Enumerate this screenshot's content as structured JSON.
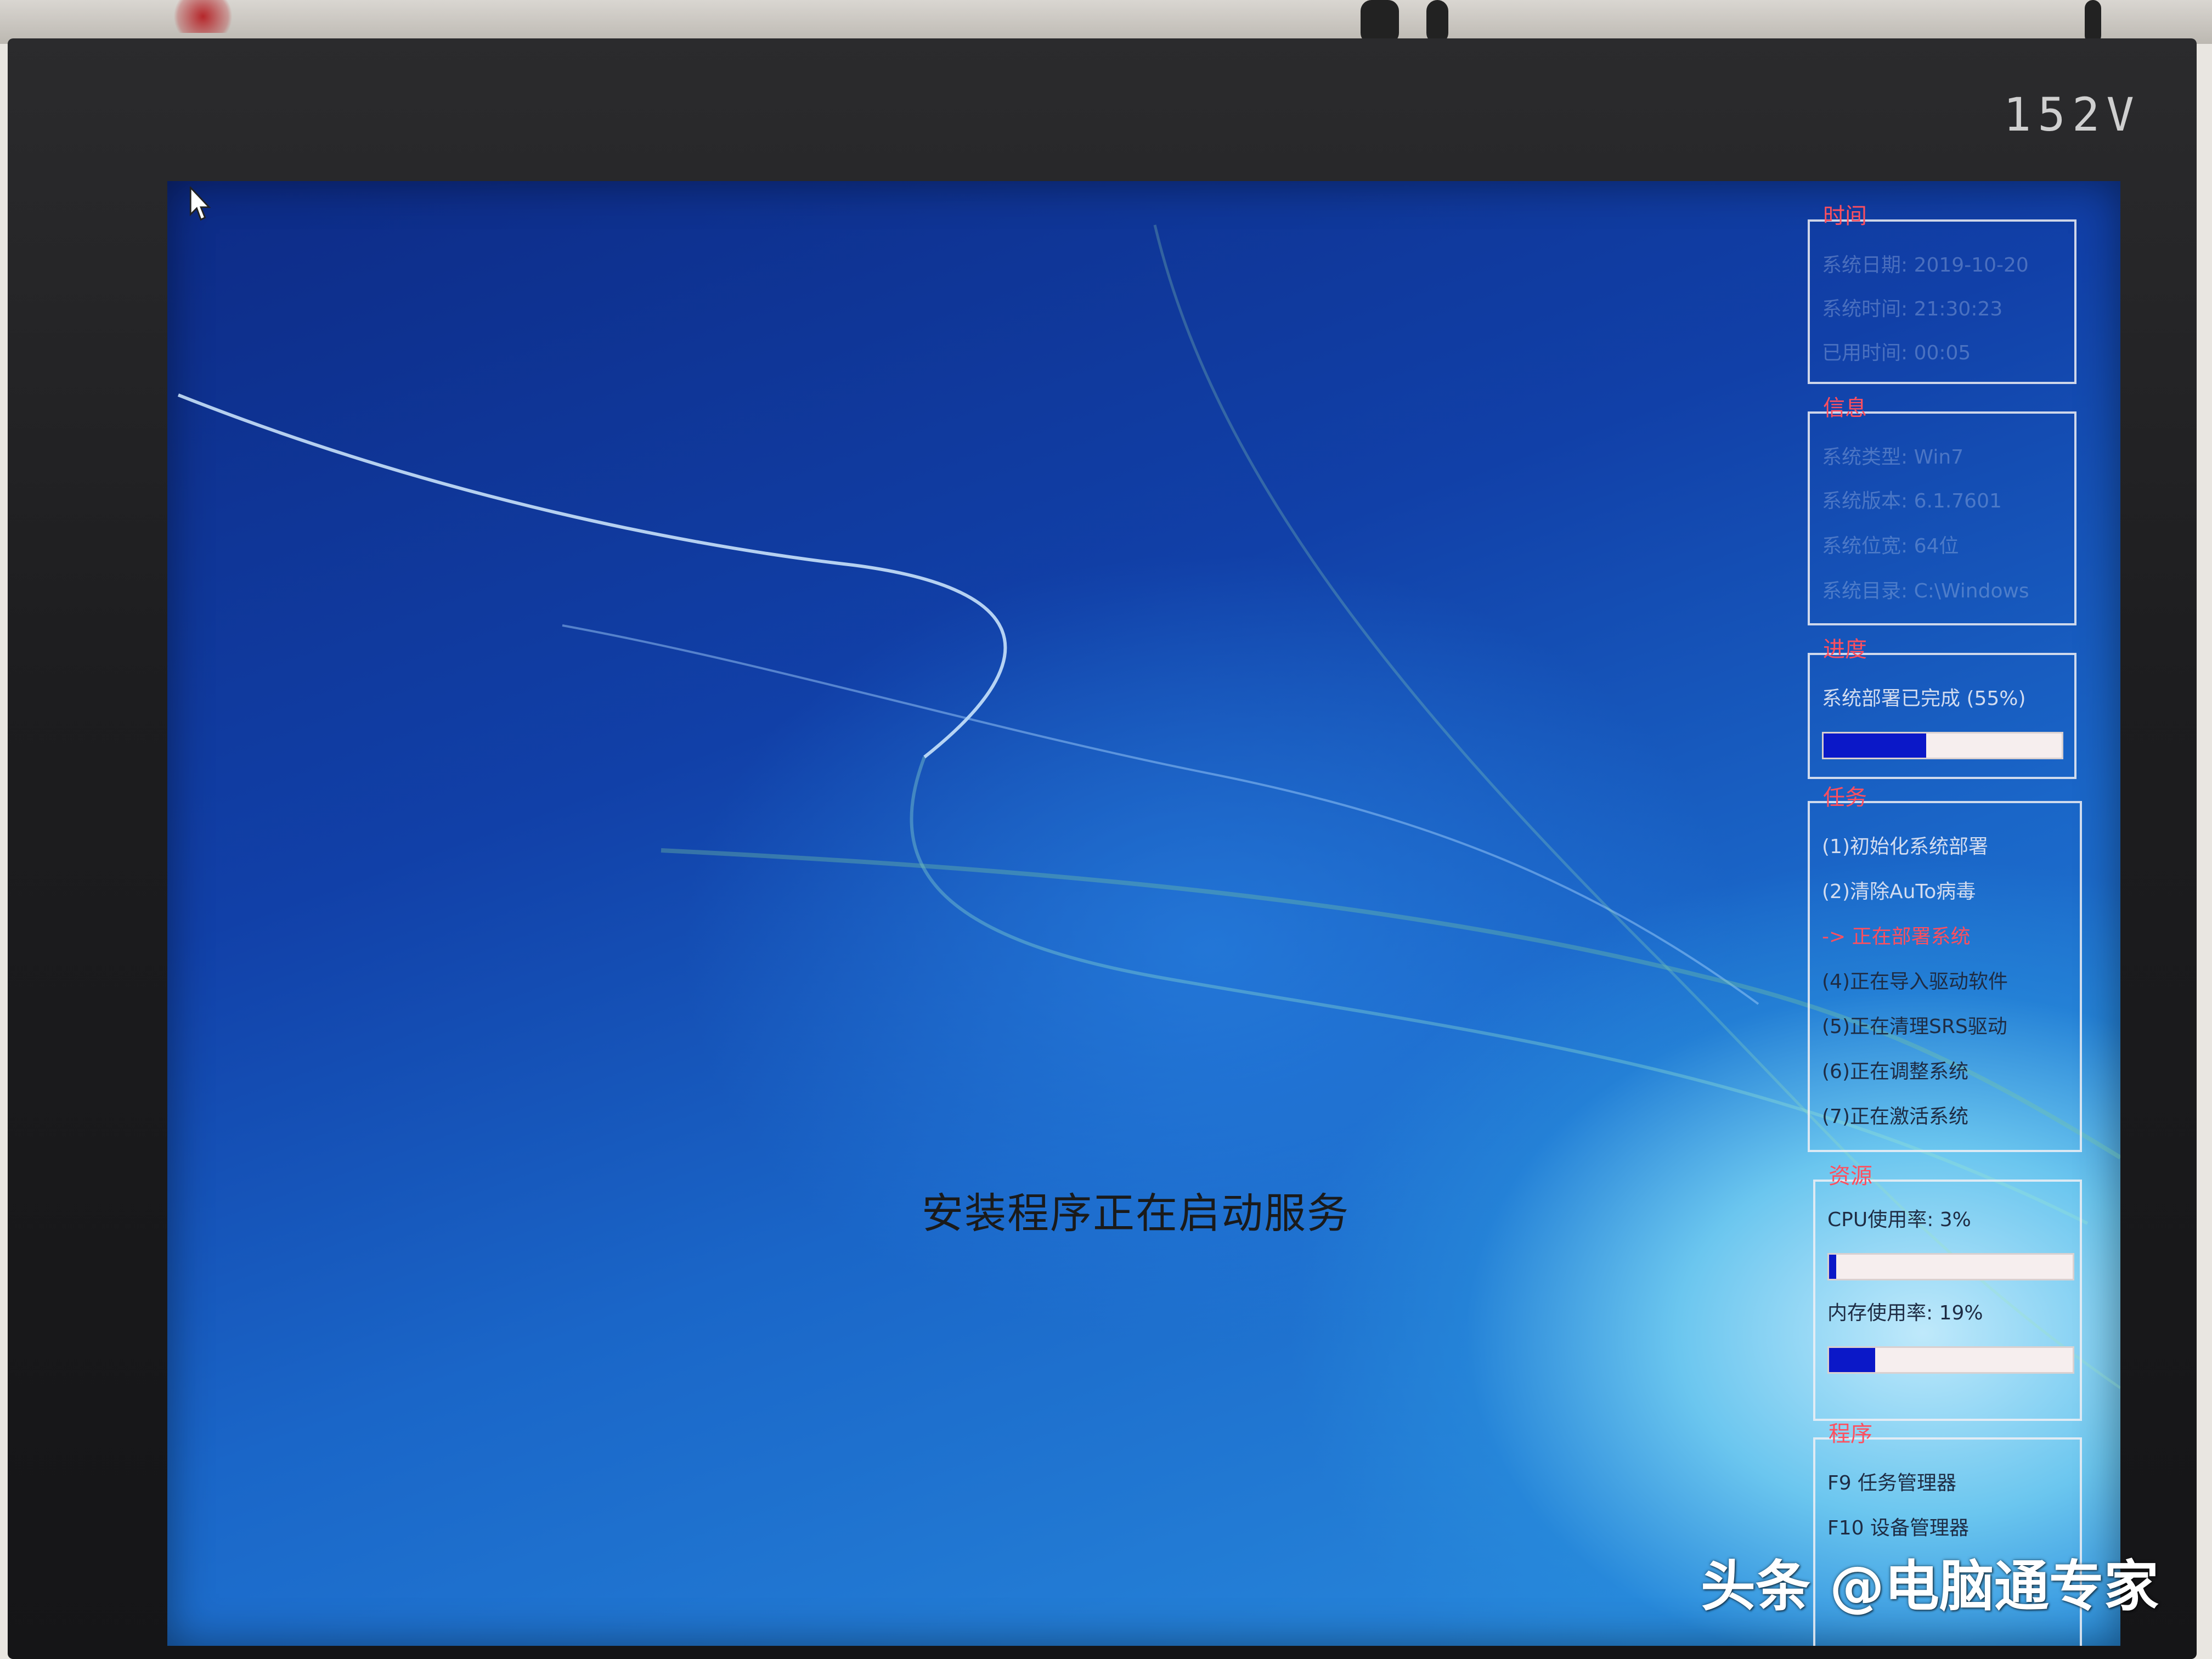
{
  "monitor": {
    "brand": "152V"
  },
  "center_status": "安装程序正在启动服务",
  "panels": {
    "time": {
      "title": "时间",
      "rows": [
        "系统日期:  2019-10-20",
        "系统时间:  21:30:23",
        "已用时间:  00:05"
      ]
    },
    "info": {
      "title": "信息",
      "rows": [
        "系统类型:  Win7",
        "系统版本:  6.1.7601",
        "系统位宽:  64位",
        "系统目录:  C:\\Windows"
      ]
    },
    "progress": {
      "title": "进度",
      "label": "系统部署已完成 (55%)",
      "percent": 43
    },
    "tasks": {
      "title": "任务",
      "items": [
        "(1)初始化系统部署",
        "(2)清除AuTo病毒",
        "-> 正在部署系统",
        "(4)正在导入驱动软件",
        "(5)正在清理SRS驱动",
        "(6)正在调整系统",
        "(7)正在激活系统"
      ],
      "active_index": 2
    },
    "resources": {
      "title": "资源",
      "cpu_label": "CPU使用率:  3%",
      "cpu_percent": 3,
      "mem_label": "内存使用率: 19%",
      "mem_percent": 19
    },
    "programs": {
      "title": "程序",
      "items": [
        "F9   任务管理器",
        "F10  设备管理器"
      ]
    }
  },
  "watermark": "头条 @电脑通专家",
  "colors": {
    "panel_title": "#ff4f5e",
    "bar_fill": "#0b18c8",
    "bar_track": "#f6eeee"
  },
  "icons": [
    "mouse-cursor-icon"
  ]
}
